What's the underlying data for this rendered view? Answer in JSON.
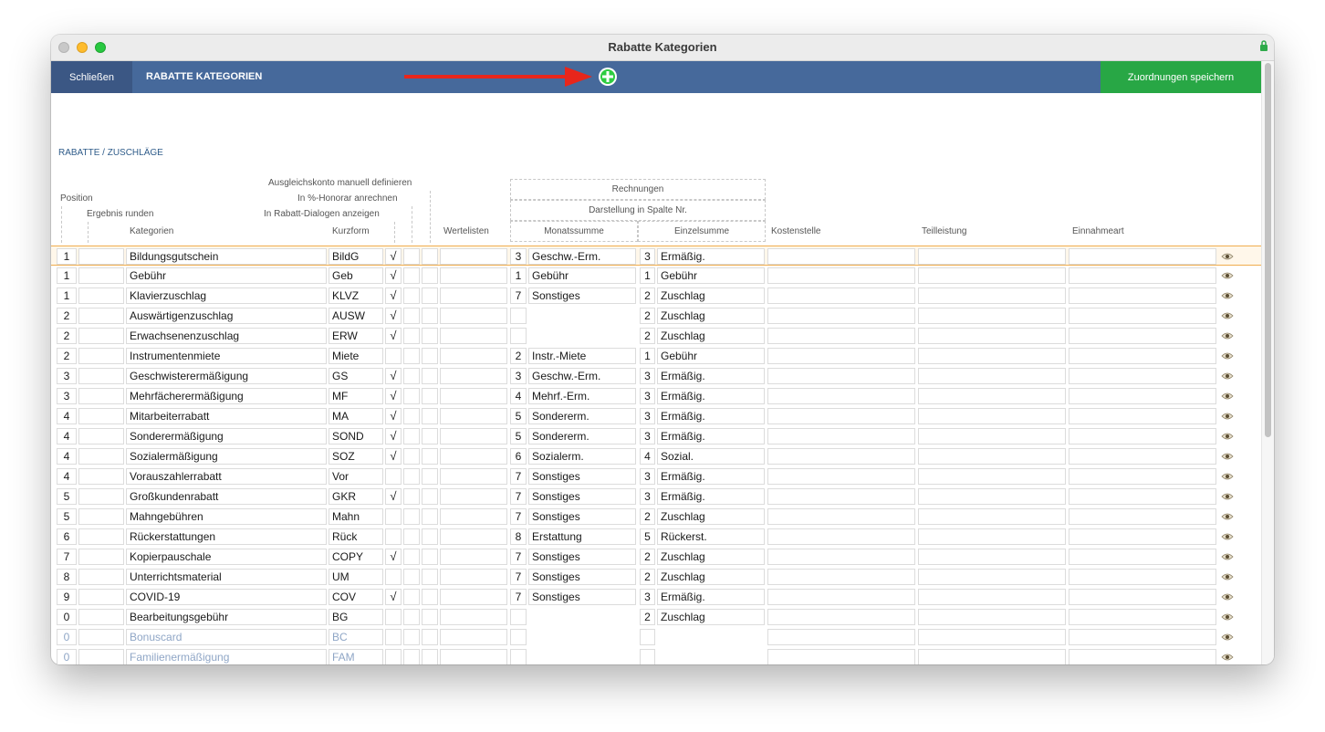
{
  "window": {
    "title": "Rabatte Kategorien"
  },
  "toolbar": {
    "close_label": "Schließen",
    "title": "RABATTE KATEGORIEN",
    "save_label": "Zuordnungen speichern"
  },
  "colors": {
    "toolbar": "#46699b",
    "save": "#28a745",
    "add_icon": "#2ecc40",
    "arrow": "#e8261b",
    "selected_border": "#f0ad4e"
  },
  "section": {
    "title": "RABATTE / ZUSCHLÄGE"
  },
  "headers": {
    "ausgleichskonto": "Ausgleichskonto manuell definieren",
    "honorar": "In %-Honorar anrechnen",
    "position": "Position",
    "dialogen": "In Rabatt-Dialogen anzeigen",
    "ergebnis": "Ergebnis runden",
    "kategorien": "Kategorien",
    "kurzform": "Kurzform",
    "wertelisten": "Wertelisten",
    "rechnungen": "Rechnungen",
    "darstellung": "Darstellung in Spalte Nr.",
    "monatssumme": "Monatssumme",
    "einzelsumme": "Einzelsumme",
    "kostenstelle": "Kostenstelle",
    "teilleistung": "Teilleistung",
    "einnahmeart": "Einnahmeart"
  },
  "rows": [
    {
      "pos": "1",
      "kat": "Bildungsgutschein",
      "kurz": "BildG",
      "chk": "√",
      "mnum": "3",
      "mtext": "Geschw.-Erm.",
      "enum": "3",
      "etext": "Ermäßig.",
      "selected": true,
      "inactive": false
    },
    {
      "pos": "1",
      "kat": "Gebühr",
      "kurz": "Geb",
      "chk": "√",
      "mnum": "1",
      "mtext": "Gebühr",
      "enum": "1",
      "etext": "Gebühr",
      "selected": false,
      "inactive": false
    },
    {
      "pos": "1",
      "kat": "Klavierzuschlag",
      "kurz": "KLVZ",
      "chk": "√",
      "mnum": "7",
      "mtext": "Sonstiges",
      "enum": "2",
      "etext": "Zuschlag",
      "selected": false,
      "inactive": false
    },
    {
      "pos": "2",
      "kat": "Auswärtigenzuschlag",
      "kurz": "AUSW",
      "chk": "√",
      "mnum": "",
      "mtext": null,
      "enum": "2",
      "etext": "Zuschlag",
      "selected": false,
      "inactive": false
    },
    {
      "pos": "2",
      "kat": "Erwachsenenzuschlag",
      "kurz": "ERW",
      "chk": "√",
      "mnum": "",
      "mtext": null,
      "enum": "2",
      "etext": "Zuschlag",
      "selected": false,
      "inactive": false
    },
    {
      "pos": "2",
      "kat": "Instrumentenmiete",
      "kurz": "Miete",
      "chk": "",
      "mnum": "2",
      "mtext": "Instr.-Miete",
      "enum": "1",
      "etext": "Gebühr",
      "selected": false,
      "inactive": false
    },
    {
      "pos": "3",
      "kat": "Geschwisterermäßigung",
      "kurz": "GS",
      "chk": "√",
      "mnum": "3",
      "mtext": "Geschw.-Erm.",
      "enum": "3",
      "etext": "Ermäßig.",
      "selected": false,
      "inactive": false
    },
    {
      "pos": "3",
      "kat": "Mehrfächerermäßigung",
      "kurz": "MF",
      "chk": "√",
      "mnum": "4",
      "mtext": "Mehrf.-Erm.",
      "enum": "3",
      "etext": "Ermäßig.",
      "selected": false,
      "inactive": false
    },
    {
      "pos": "4",
      "kat": "Mitarbeiterrabatt",
      "kurz": "MA",
      "chk": "√",
      "mnum": "5",
      "mtext": "Sondererm.",
      "enum": "3",
      "etext": "Ermäßig.",
      "selected": false,
      "inactive": false
    },
    {
      "pos": "4",
      "kat": "Sonderermäßigung",
      "kurz": "SOND",
      "chk": "√",
      "mnum": "5",
      "mtext": "Sondererm.",
      "enum": "3",
      "etext": "Ermäßig.",
      "selected": false,
      "inactive": false
    },
    {
      "pos": "4",
      "kat": "Sozialermäßigung",
      "kurz": "SOZ",
      "chk": "√",
      "mnum": "6",
      "mtext": "Sozialerm.",
      "enum": "4",
      "etext": "Sozial.",
      "selected": false,
      "inactive": false
    },
    {
      "pos": "4",
      "kat": "Vorauszahlerrabatt",
      "kurz": "Vor",
      "chk": "",
      "mnum": "7",
      "mtext": "Sonstiges",
      "enum": "3",
      "etext": "Ermäßig.",
      "selected": false,
      "inactive": false
    },
    {
      "pos": "5",
      "kat": "Großkundenrabatt",
      "kurz": "GKR",
      "chk": "√",
      "mnum": "7",
      "mtext": "Sonstiges",
      "enum": "3",
      "etext": "Ermäßig.",
      "selected": false,
      "inactive": false
    },
    {
      "pos": "5",
      "kat": "Mahngebühren",
      "kurz": "Mahn",
      "chk": "",
      "mnum": "7",
      "mtext": "Sonstiges",
      "enum": "2",
      "etext": "Zuschlag",
      "selected": false,
      "inactive": false
    },
    {
      "pos": "6",
      "kat": "Rückerstattungen",
      "kurz": "Rück",
      "chk": "",
      "mnum": "8",
      "mtext": "Erstattung",
      "enum": "5",
      "etext": "Rückerst.",
      "selected": false,
      "inactive": false
    },
    {
      "pos": "7",
      "kat": "Kopierpauschale",
      "kurz": "COPY",
      "chk": "√",
      "mnum": "7",
      "mtext": "Sonstiges",
      "enum": "2",
      "etext": "Zuschlag",
      "selected": false,
      "inactive": false
    },
    {
      "pos": "8",
      "kat": "Unterrichtsmaterial",
      "kurz": "UM",
      "chk": "",
      "mnum": "7",
      "mtext": "Sonstiges",
      "enum": "2",
      "etext": "Zuschlag",
      "selected": false,
      "inactive": false
    },
    {
      "pos": "9",
      "kat": "COVID-19",
      "kurz": "COV",
      "chk": "√",
      "mnum": "7",
      "mtext": "Sonstiges",
      "enum": "3",
      "etext": "Ermäßig.",
      "selected": false,
      "inactive": false
    },
    {
      "pos": "0",
      "kat": "Bearbeitungsgebühr",
      "kurz": "BG",
      "chk": "",
      "mnum": "",
      "mtext": null,
      "enum": "2",
      "etext": "Zuschlag",
      "selected": false,
      "inactive": false
    },
    {
      "pos": "0",
      "kat": "Bonuscard",
      "kurz": "BC",
      "chk": "",
      "mnum": "",
      "mtext": null,
      "enum": "",
      "etext": null,
      "selected": false,
      "inactive": true
    },
    {
      "pos": "0",
      "kat": "Familienermäßigung",
      "kurz": "FAM",
      "chk": "",
      "mnum": "",
      "mtext": null,
      "enum": "",
      "etext": null,
      "selected": false,
      "inactive": true
    }
  ]
}
